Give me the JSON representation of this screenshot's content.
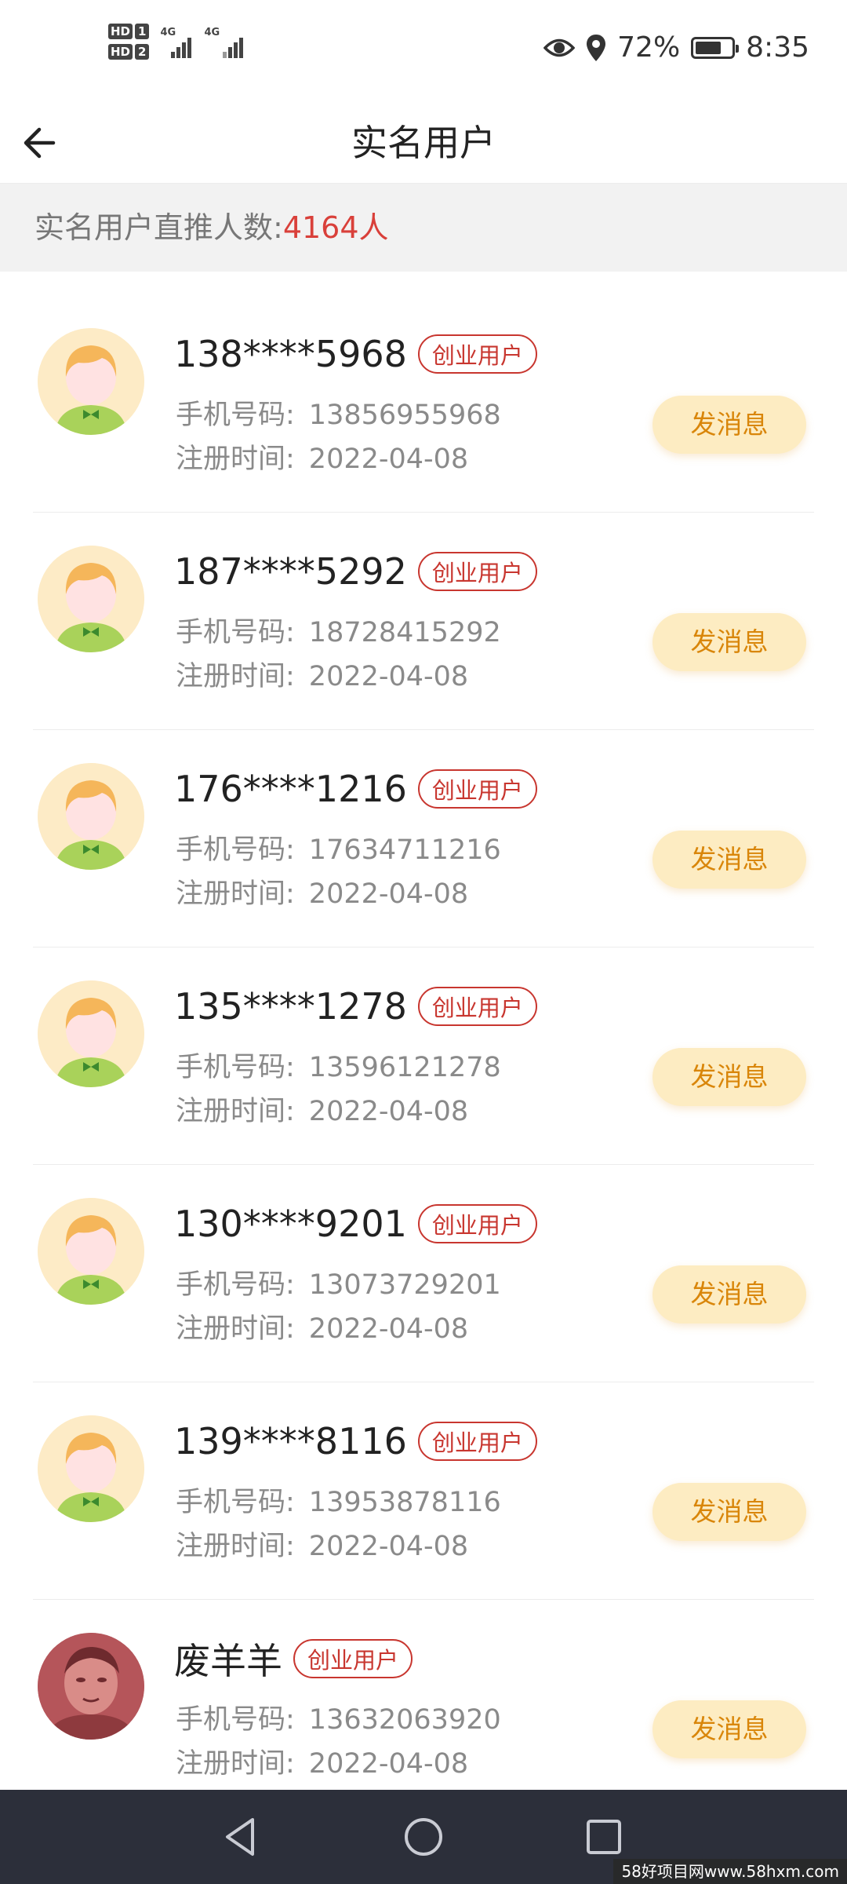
{
  "status_bar": {
    "hd1": "HD",
    "hd1_num": "1",
    "hd2": "HD",
    "hd2_num": "2",
    "net1": "4G",
    "net2": "4G",
    "battery_percent": "72%",
    "battery_level": 0.72,
    "time": "8:35",
    "icons": [
      "eye-icon",
      "location-icon",
      "battery-icon"
    ]
  },
  "header": {
    "title": "实名用户",
    "back_icon": "arrow-left-icon"
  },
  "summary": {
    "label": "实名用户直推人数:",
    "count": "4164人"
  },
  "users": [
    {
      "name": "138****5968",
      "badge": "创业用户",
      "phone_label": "手机号码:",
      "phone": "13856955968",
      "reg_label": "注册时间:",
      "reg_date": "2022-04-08",
      "button": "发消息",
      "avatar": "default"
    },
    {
      "name": "187****5292",
      "badge": "创业用户",
      "phone_label": "手机号码:",
      "phone": "18728415292",
      "reg_label": "注册时间:",
      "reg_date": "2022-04-08",
      "button": "发消息",
      "avatar": "default"
    },
    {
      "name": "176****1216",
      "badge": "创业用户",
      "phone_label": "手机号码:",
      "phone": "17634711216",
      "reg_label": "注册时间:",
      "reg_date": "2022-04-08",
      "button": "发消息",
      "avatar": "default"
    },
    {
      "name": "135****1278",
      "badge": "创业用户",
      "phone_label": "手机号码:",
      "phone": "13596121278",
      "reg_label": "注册时间:",
      "reg_date": "2022-04-08",
      "button": "发消息",
      "avatar": "default"
    },
    {
      "name": "130****9201",
      "badge": "创业用户",
      "phone_label": "手机号码:",
      "phone": "13073729201",
      "reg_label": "注册时间:",
      "reg_date": "2022-04-08",
      "button": "发消息",
      "avatar": "default"
    },
    {
      "name": "139****8116",
      "badge": "创业用户",
      "phone_label": "手机号码:",
      "phone": "13953878116",
      "reg_label": "注册时间:",
      "reg_date": "2022-04-08",
      "button": "发消息",
      "avatar": "default"
    },
    {
      "name": "废羊羊",
      "badge": "创业用户",
      "phone_label": "手机号码:",
      "phone": "13632063920",
      "reg_label": "注册时间:",
      "reg_date": "2022-04-08",
      "button": "发消息",
      "avatar": "photo"
    }
  ],
  "nav_bar": {
    "icons": [
      "back-triangle-icon",
      "home-circle-icon",
      "recents-square-icon"
    ]
  },
  "watermark": "58好项目网www.58hxm.com",
  "colors": {
    "accent_red": "#d9403a",
    "badge_red": "#c8362f",
    "button_bg": "#fdecc2",
    "button_text": "#d9860a",
    "nav_bg": "#2c2f3a"
  }
}
